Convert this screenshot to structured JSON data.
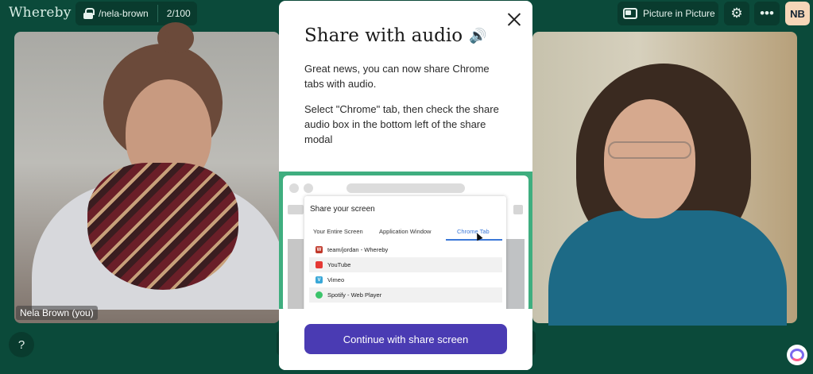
{
  "app": {
    "logo": "Whereby"
  },
  "room": {
    "name": "/nela-brown",
    "count": "2/100"
  },
  "header": {
    "pip_label": "Picture in Picture",
    "avatar_initials": "NB"
  },
  "tiles": {
    "left_name": "Nela Brown (you)"
  },
  "help": {
    "label": "?"
  },
  "modal": {
    "title": "Share with audio",
    "title_icon": "speaker-icon",
    "paragraph1": "Great news, you can now share Chrome tabs with audio.",
    "paragraph2": "Select \"Chrome\" tab, then check the share audio box in the bottom left of the share modal",
    "continue_label": "Continue with share screen"
  },
  "preview": {
    "dialog_title": "Share your screen",
    "tabs": [
      "Your Entire Screen",
      "Application Window",
      "Chrome Tab"
    ],
    "active_tab": "Chrome Tab",
    "items": [
      {
        "label": "team/jordan - Whereby",
        "icon": "W",
        "color": "#c0392b"
      },
      {
        "label": "YouTube",
        "icon": "",
        "color": "#e53935"
      },
      {
        "label": "Vimeo",
        "icon": "V",
        "color": "#3aa8d8"
      },
      {
        "label": "Spotify - Web Player",
        "icon": "",
        "color": "#3cc46b"
      }
    ]
  },
  "colors": {
    "background": "#0b4a3a",
    "accent_button": "#4a3bb3",
    "preview_border": "#3fae7f"
  }
}
